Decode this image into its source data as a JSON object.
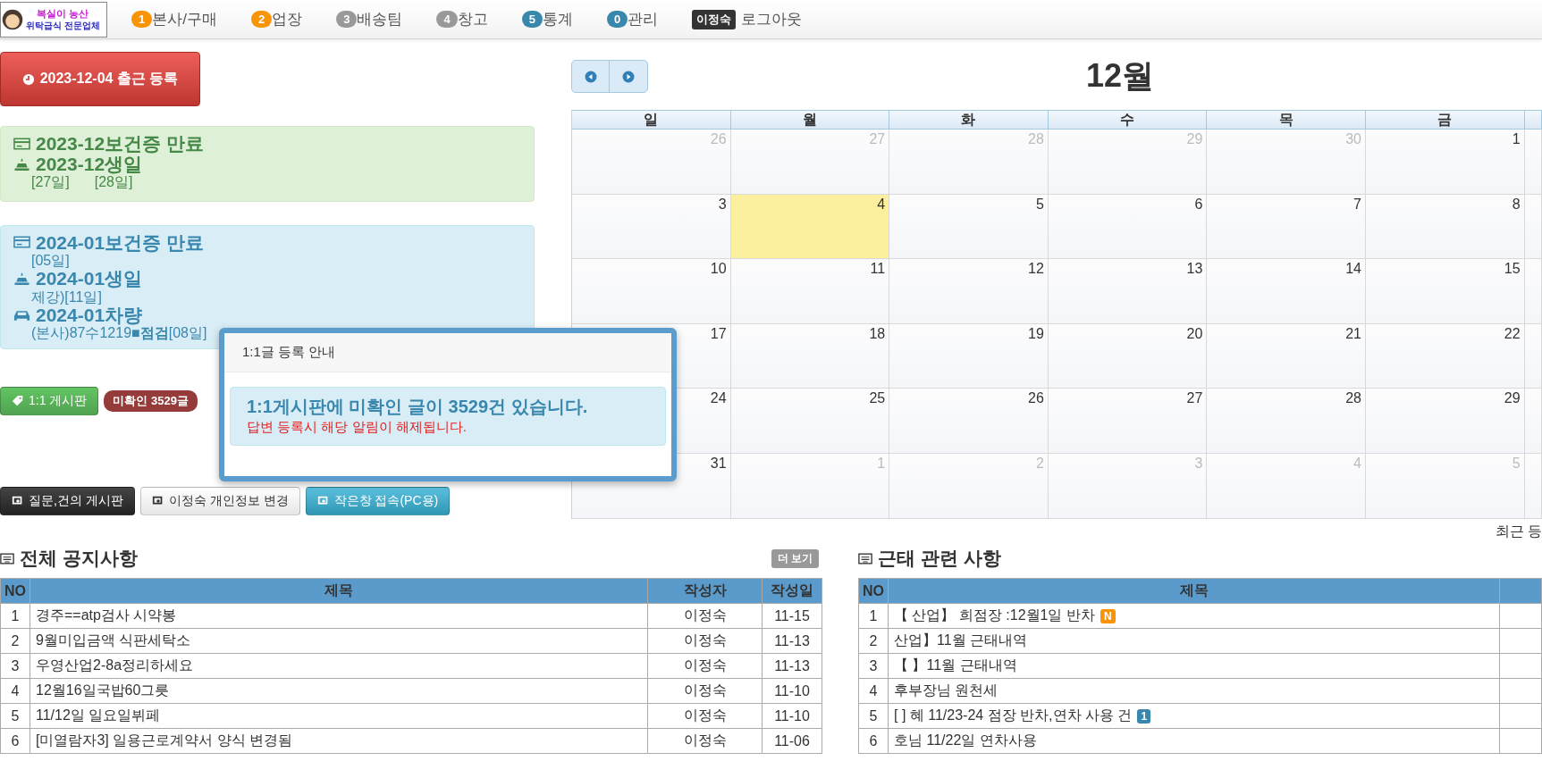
{
  "logo": {
    "title": "복실이 농산",
    "subtitle": "위탁급식 전문업체"
  },
  "nav": [
    {
      "badge": "1",
      "label": "본사/구매",
      "color": "#f89406"
    },
    {
      "badge": "2",
      "label": "업장",
      "color": "#f89406"
    },
    {
      "badge": "3",
      "label": "배송팀",
      "color": "#999999"
    },
    {
      "badge": "4",
      "label": "창고",
      "color": "#999999"
    },
    {
      "badge": "5",
      "label": "통계",
      "color": "#3a87ad"
    },
    {
      "badge": "0",
      "label": "관리",
      "color": "#3a87ad"
    },
    {
      "badge": "이정숙",
      "label": "로그아웃",
      "color": "#333333"
    }
  ],
  "checkin_button": "2023-12-04 출근 등록",
  "alerts": [
    {
      "kind": "success",
      "lines": [
        {
          "kind": "card",
          "text": "2023-12보건증 만료"
        },
        {
          "kind": "cake",
          "text": "2023-12생일"
        },
        {
          "kind": "names",
          "items": [
            "[27일]",
            "[28일]"
          ]
        }
      ]
    },
    {
      "kind": "info",
      "lines": [
        {
          "kind": "card",
          "text": "2024-01보건증 만료"
        },
        {
          "kind": "names",
          "items": [
            "[05일]"
          ]
        },
        {
          "kind": "cake",
          "text": "2024-01생일"
        },
        {
          "kind": "names",
          "items": [
            "제강)[11일]"
          ]
        },
        {
          "kind": "car",
          "text": "2024-01차량"
        },
        {
          "kind": "names",
          "items": [
            "(본사)87수1219■**점검**[08일]"
          ]
        }
      ]
    }
  ],
  "board_button": "1:1 게시판",
  "unread_badge": "미확인 3529글",
  "popover": {
    "title": "1:1글 등록 안내",
    "message": "1:1게시판에 미확인 글이 3529건 있습니다.",
    "note": "답변 등록시 해당 알림이 해제됩니다."
  },
  "action_buttons": [
    {
      "kind": "dark",
      "label": "질문,건의 게시판"
    },
    {
      "kind": "light",
      "label": "이정숙 개인정보 변경"
    },
    {
      "kind": "info",
      "label": "작은창 접속(PC용)"
    }
  ],
  "calendar": {
    "title": "12월",
    "weekdays": [
      "일",
      "월",
      "화",
      "수",
      "목",
      "금"
    ],
    "weeks": [
      [
        {
          "day": "26",
          "muted": true,
          "today": false
        },
        {
          "day": "27",
          "muted": true,
          "today": false
        },
        {
          "day": "28",
          "muted": true,
          "today": false
        },
        {
          "day": "29",
          "muted": true,
          "today": false
        },
        {
          "day": "30",
          "muted": true,
          "today": false
        },
        {
          "day": "1",
          "muted": false,
          "today": false
        }
      ],
      [
        {
          "day": "3",
          "muted": false,
          "today": false
        },
        {
          "day": "4",
          "muted": false,
          "today": true
        },
        {
          "day": "5",
          "muted": false,
          "today": false
        },
        {
          "day": "6",
          "muted": false,
          "today": false
        },
        {
          "day": "7",
          "muted": false,
          "today": false
        },
        {
          "day": "8",
          "muted": false,
          "today": false
        }
      ],
      [
        {
          "day": "10",
          "muted": false,
          "today": false
        },
        {
          "day": "11",
          "muted": false,
          "today": false
        },
        {
          "day": "12",
          "muted": false,
          "today": false
        },
        {
          "day": "13",
          "muted": false,
          "today": false
        },
        {
          "day": "14",
          "muted": false,
          "today": false
        },
        {
          "day": "15",
          "muted": false,
          "today": false
        }
      ],
      [
        {
          "day": "17",
          "muted": false,
          "today": false
        },
        {
          "day": "18",
          "muted": false,
          "today": false
        },
        {
          "day": "19",
          "muted": false,
          "today": false
        },
        {
          "day": "20",
          "muted": false,
          "today": false
        },
        {
          "day": "21",
          "muted": false,
          "today": false
        },
        {
          "day": "22",
          "muted": false,
          "today": false
        }
      ],
      [
        {
          "day": "24",
          "muted": false,
          "today": false
        },
        {
          "day": "25",
          "muted": false,
          "today": false
        },
        {
          "day": "26",
          "muted": false,
          "today": false
        },
        {
          "day": "27",
          "muted": false,
          "today": false
        },
        {
          "day": "28",
          "muted": false,
          "today": false
        },
        {
          "day": "29",
          "muted": false,
          "today": false
        }
      ],
      [
        {
          "day": "31",
          "muted": false,
          "today": false
        },
        {
          "day": "1",
          "muted": true,
          "today": false
        },
        {
          "day": "2",
          "muted": true,
          "today": false
        },
        {
          "day": "3",
          "muted": true,
          "today": false
        },
        {
          "day": "4",
          "muted": true,
          "today": false
        },
        {
          "day": "5",
          "muted": true,
          "today": false
        }
      ]
    ],
    "footer": "최근 등"
  },
  "notices": {
    "title": "전체 공지사항",
    "more": "더 보기",
    "columns": [
      "NO",
      "제목",
      "작성자",
      "작성일"
    ],
    "rows": [
      [
        "1",
        "경주==atp검사 시약봉",
        "이정숙",
        "11-15"
      ],
      [
        "2",
        "9월미입금액 식판세탁소",
        "이정숙",
        "11-13"
      ],
      [
        "3",
        "우영산업2-8a정리하세요",
        "이정숙",
        "11-13"
      ],
      [
        "4",
        "12월16일국밥60그릇",
        "이정숙",
        "11-10"
      ],
      [
        "5",
        "11/12일 일요일뷔페",
        "이정숙",
        "11-10"
      ],
      [
        "6",
        "[미열람자3] 일용근로계약서 양식 변경됨",
        "이정숙",
        "11-06"
      ]
    ]
  },
  "attendance": {
    "title": "근태 관련 사항",
    "columns": [
      "NO",
      "제목"
    ],
    "rows": [
      {
        "no": "1",
        "title": "【 산업】 희점장 :12월1일 반차",
        "badge": "N",
        "kind": "new"
      },
      {
        "no": "2",
        "title": "산업】11월 근태내역"
      },
      {
        "no": "3",
        "title": "【 】11월 근태내역"
      },
      {
        "no": "4",
        "title": "후부장님 원천세"
      },
      {
        "no": "5",
        "title": "[ ] 혜 11/23-24 점장 반차,연차 사용 건",
        "badge": "1",
        "kind": "count"
      },
      {
        "no": "6",
        "title": "호님 11/22일 연차사용"
      }
    ]
  }
}
